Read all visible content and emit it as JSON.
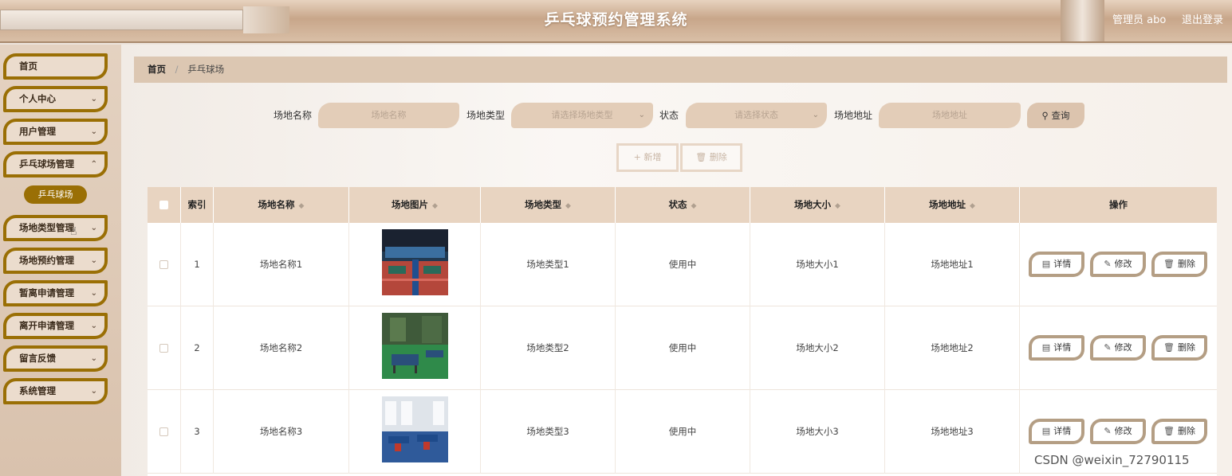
{
  "header": {
    "title": "乒乓球预约管理系统",
    "user": "管理员 abo",
    "logout": "退出登录"
  },
  "sidebar": {
    "items": [
      {
        "label": "首页",
        "has_children": false
      },
      {
        "label": "个人中心",
        "has_children": true
      },
      {
        "label": "用户管理",
        "has_children": true
      },
      {
        "label": "乒乓球场管理",
        "has_children": true
      },
      {
        "label": "场地类型管理",
        "has_children": true
      },
      {
        "label": "场地预约管理",
        "has_children": true
      },
      {
        "label": "暂离申请管理",
        "has_children": true
      },
      {
        "label": "离开申请管理",
        "has_children": true
      },
      {
        "label": "留言反馈",
        "has_children": true
      },
      {
        "label": "系统管理",
        "has_children": true
      }
    ],
    "active_sub": "乒乓球场"
  },
  "breadcrumb": {
    "home": "首页",
    "separator": "/",
    "current": "乒乓球场"
  },
  "search": {
    "name_label": "场地名称",
    "name_placeholder": "场地名称",
    "type_label": "场地类型",
    "type_placeholder": "请选择场地类型",
    "status_label": "状态",
    "status_placeholder": "请选择状态",
    "address_label": "场地地址",
    "address_placeholder": "场地地址",
    "query_button": "查询"
  },
  "actions": {
    "add": "新增",
    "delete": "删除"
  },
  "table": {
    "columns": [
      "索引",
      "场地名称",
      "场地图片",
      "场地类型",
      "状态",
      "场地大小",
      "场地地址",
      "操作"
    ],
    "rows": [
      {
        "index": "1",
        "name": "场地名称1",
        "image": "indoor-table-tennis-hall",
        "type": "场地类型1",
        "status": "使用中",
        "size": "场地大小1",
        "address": "场地地址1"
      },
      {
        "index": "2",
        "name": "场地名称2",
        "image": "outdoor-table-tennis-court",
        "type": "场地类型2",
        "status": "使用中",
        "size": "场地大小2",
        "address": "场地地址2"
      },
      {
        "index": "3",
        "name": "场地名称3",
        "image": "bright-table-tennis-room",
        "type": "场地类型3",
        "status": "使用中",
        "size": "场地大小3",
        "address": "场地地址3"
      }
    ],
    "row_actions": {
      "detail": "详情",
      "edit": "修改",
      "delete": "删除"
    }
  },
  "watermark": "CSDN @weixin_72790115",
  "colors": {
    "accent": "#9a6f05",
    "header_bg": "#c8a68a",
    "table_header": "#e8d4c1",
    "button_border": "#b49e84"
  }
}
